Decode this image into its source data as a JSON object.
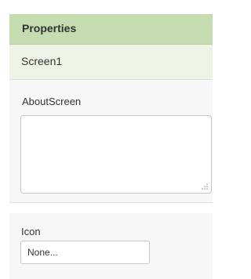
{
  "panel": {
    "title": "Properties",
    "component_name": "Screen1"
  },
  "properties": {
    "about_screen": {
      "label": "AboutScreen",
      "value": ""
    },
    "icon": {
      "label": "Icon",
      "value": "None..."
    }
  },
  "colors": {
    "header_bg": "#c5dcb0",
    "component_bg": "#eef3e8",
    "section_bg": "#f7f7f7"
  }
}
